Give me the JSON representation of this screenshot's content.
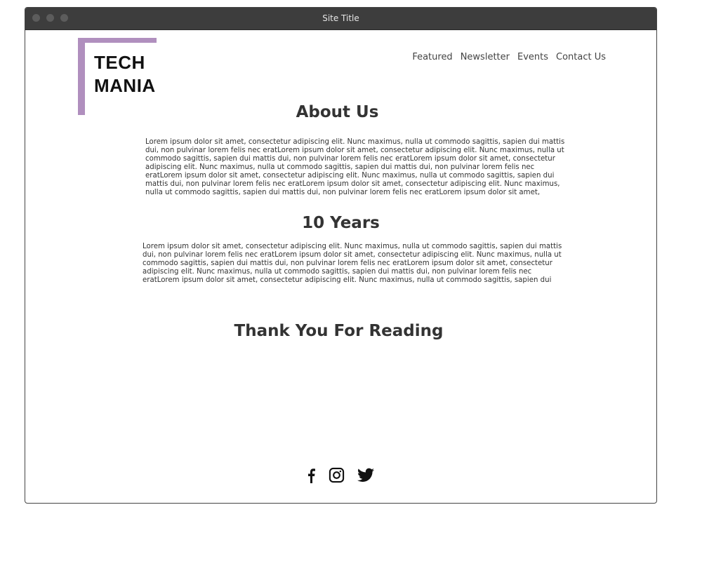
{
  "window": {
    "title": "Site Title"
  },
  "logo": {
    "line1": "TECH",
    "line2": "MANIA",
    "accent_color": "#b08fbe"
  },
  "nav": {
    "items": [
      {
        "label": "Featured"
      },
      {
        "label": "Newsletter"
      },
      {
        "label": "Events"
      },
      {
        "label": "Contact Us"
      }
    ]
  },
  "about": {
    "heading": "About Us",
    "lines": [
      "Lorem ipsum dolor sit amet, consectetur adipiscing elit. Nunc maximus, nulla ut commodo sagittis, sapien dui mattis",
      "dui, non pulvinar lorem felis nec eratLorem ipsum dolor sit amet, consectetur adipiscing elit. Nunc maximus, nulla ut",
      "commodo sagittis, sapien dui mattis dui, non pulvinar lorem felis nec eratLorem ipsum dolor sit amet, consectetur",
      "adipiscing elit. Nunc maximus, nulla ut commodo sagittis, sapien dui mattis dui, non pulvinar lorem felis nec",
      "eratLorem ipsum dolor sit amet, consectetur adipiscing elit. Nunc maximus, nulla ut commodo sagittis, sapien dui",
      "mattis dui, non pulvinar lorem felis nec eratLorem ipsum dolor sit amet, consectetur adipiscing elit. Nunc maximus,",
      "nulla ut commodo sagittis, sapien dui mattis dui, non pulvinar lorem felis nec eratLorem ipsum dolor sit amet,"
    ]
  },
  "years": {
    "heading": "10 Years",
    "lines": [
      "Lorem ipsum dolor sit amet, consectetur adipiscing elit. Nunc maximus, nulla ut commodo sagittis, sapien dui mattis",
      "dui, non pulvinar lorem felis nec eratLorem ipsum dolor sit amet, consectetur adipiscing elit. Nunc maximus, nulla ut",
      "commodo sagittis, sapien dui mattis dui, non pulvinar lorem felis nec eratLorem ipsum dolor sit amet, consectetur",
      "adipiscing elit. Nunc maximus, nulla ut commodo sagittis, sapien dui mattis dui, non pulvinar lorem felis nec",
      "eratLorem ipsum dolor sit amet, consectetur adipiscing elit. Nunc maximus, nulla ut commodo sagittis, sapien dui"
    ]
  },
  "closing": {
    "heading": "Thank You For Reading"
  },
  "social": {
    "icons": [
      {
        "name": "facebook-icon"
      },
      {
        "name": "instagram-icon"
      },
      {
        "name": "twitter-icon"
      }
    ]
  }
}
